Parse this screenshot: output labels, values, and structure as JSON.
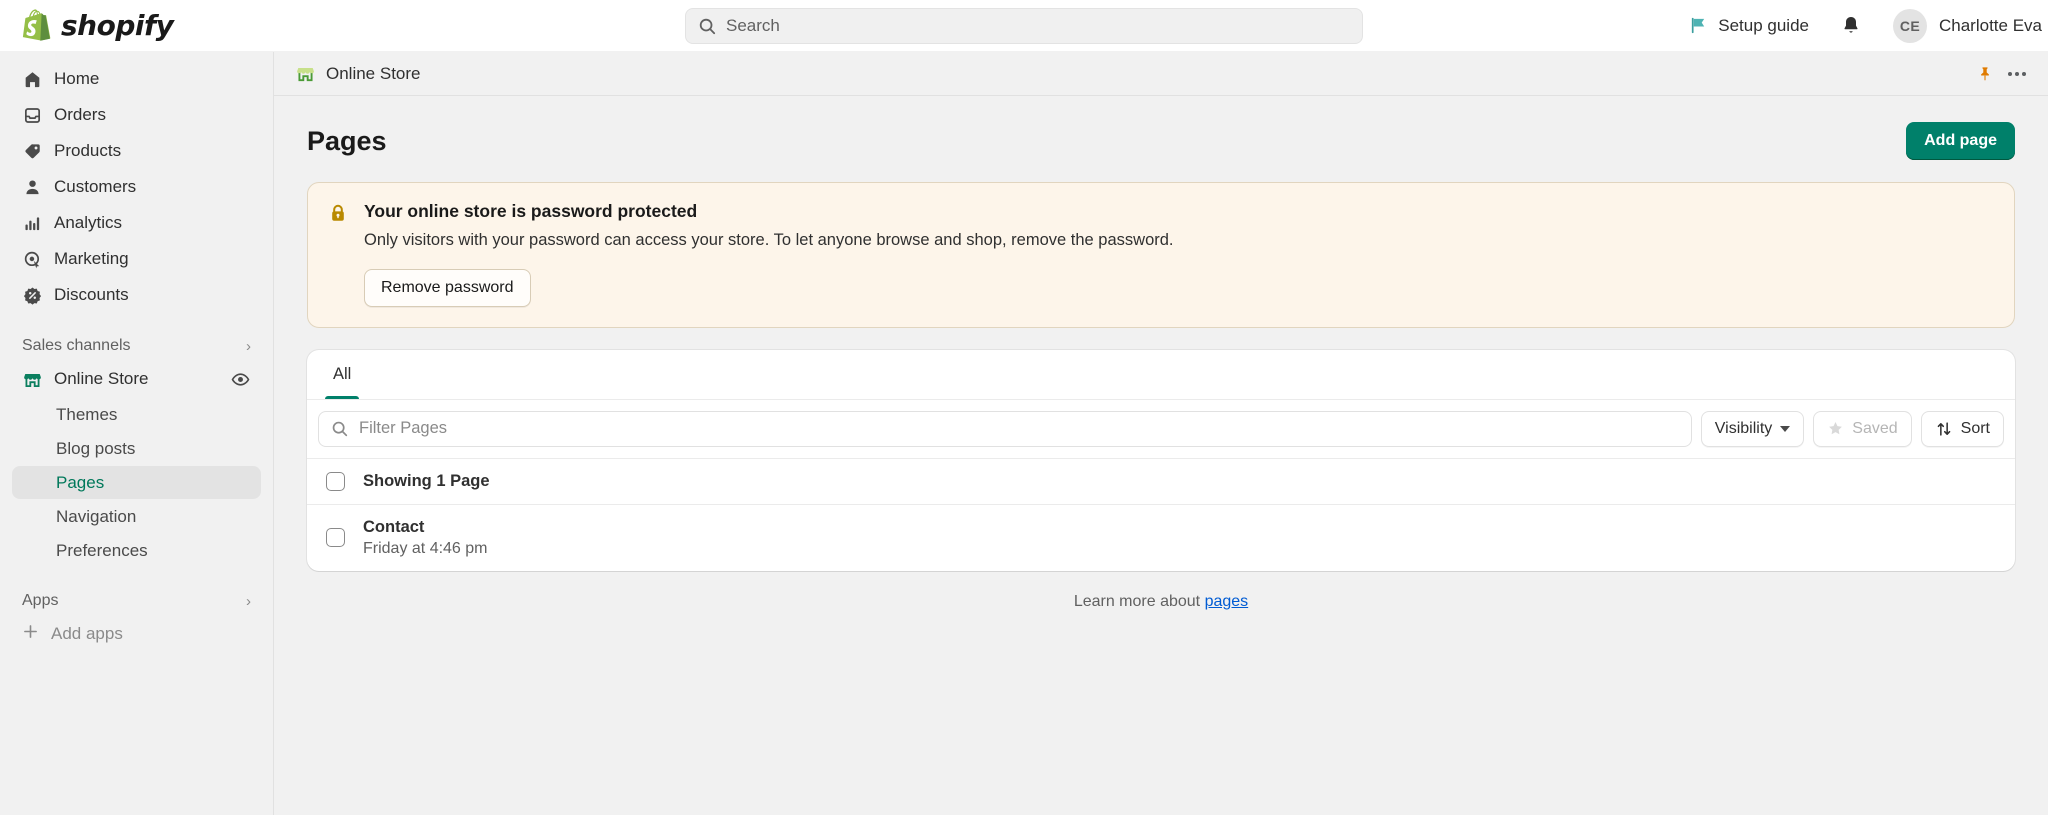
{
  "topbar": {
    "brand": "shopify",
    "search": {
      "placeholder": "Search",
      "icon": "search-icon"
    },
    "setup_guide": {
      "label": "Setup guide",
      "icon": "flag-icon"
    },
    "notifications_icon": "bell-icon",
    "user": {
      "initials": "CE",
      "name": "Charlotte Eva"
    }
  },
  "sidebar": {
    "items": [
      {
        "label": "Home",
        "icon": "home-icon"
      },
      {
        "label": "Orders",
        "icon": "orders-inbox-icon"
      },
      {
        "label": "Products",
        "icon": "product-tag-icon"
      },
      {
        "label": "Customers",
        "icon": "person-icon"
      },
      {
        "label": "Analytics",
        "icon": "bar-chart-icon"
      },
      {
        "label": "Marketing",
        "icon": "marketing-target-icon"
      },
      {
        "label": "Discounts",
        "icon": "discount-percent-icon"
      }
    ],
    "sales_channels": {
      "label": "Sales channels",
      "icon": "chevron-right-icon"
    },
    "online_store": {
      "label": "Online Store",
      "icon": "storefront-icon",
      "preview_icon": "eye-icon"
    },
    "sub_items": [
      {
        "label": "Themes",
        "active": false
      },
      {
        "label": "Blog posts",
        "active": false
      },
      {
        "label": "Pages",
        "active": true
      },
      {
        "label": "Navigation",
        "active": false
      },
      {
        "label": "Preferences",
        "active": false
      }
    ],
    "apps": {
      "label": "Apps",
      "icon": "chevron-right-icon"
    },
    "add_apps": {
      "label": "Add apps",
      "icon": "plus-icon"
    }
  },
  "breadcrumb": {
    "label": "Online Store",
    "icon": "storefront-icon",
    "pin_icon": "pin-icon",
    "more_icon": "more-horizontal-icon"
  },
  "page": {
    "title": "Pages",
    "add_button": "Add page"
  },
  "banner": {
    "icon": "lock-icon",
    "title": "Your online store is password protected",
    "body": "Only visitors with your password can access your store. To let anyone browse and shop, remove the password.",
    "action": "Remove password"
  },
  "card": {
    "tabs": [
      {
        "label": "All",
        "active": true
      }
    ],
    "filter": {
      "placeholder": "Filter Pages",
      "icon": "search-icon"
    },
    "buttons": {
      "visibility": {
        "label": "Visibility",
        "icon": "chevron-down-icon"
      },
      "saved": {
        "label": "Saved",
        "icon": "star-icon",
        "disabled": true
      },
      "sort": {
        "label": "Sort",
        "icon": "sort-arrows-icon"
      }
    },
    "showing": "Showing 1 Page",
    "rows": [
      {
        "title": "Contact",
        "subtitle": "Friday at 4:46 pm"
      }
    ]
  },
  "footer": {
    "text": "Learn more about",
    "link": "pages"
  },
  "colors": {
    "brand_green": "#00806a",
    "accent_link": "#005bd3",
    "banner_bg": "#fdf5ea",
    "banner_border": "#e1d5bf",
    "lock_amber": "#b98900",
    "pin_orange": "#e07b00",
    "sidebar_bg": "#f1f1f1"
  }
}
